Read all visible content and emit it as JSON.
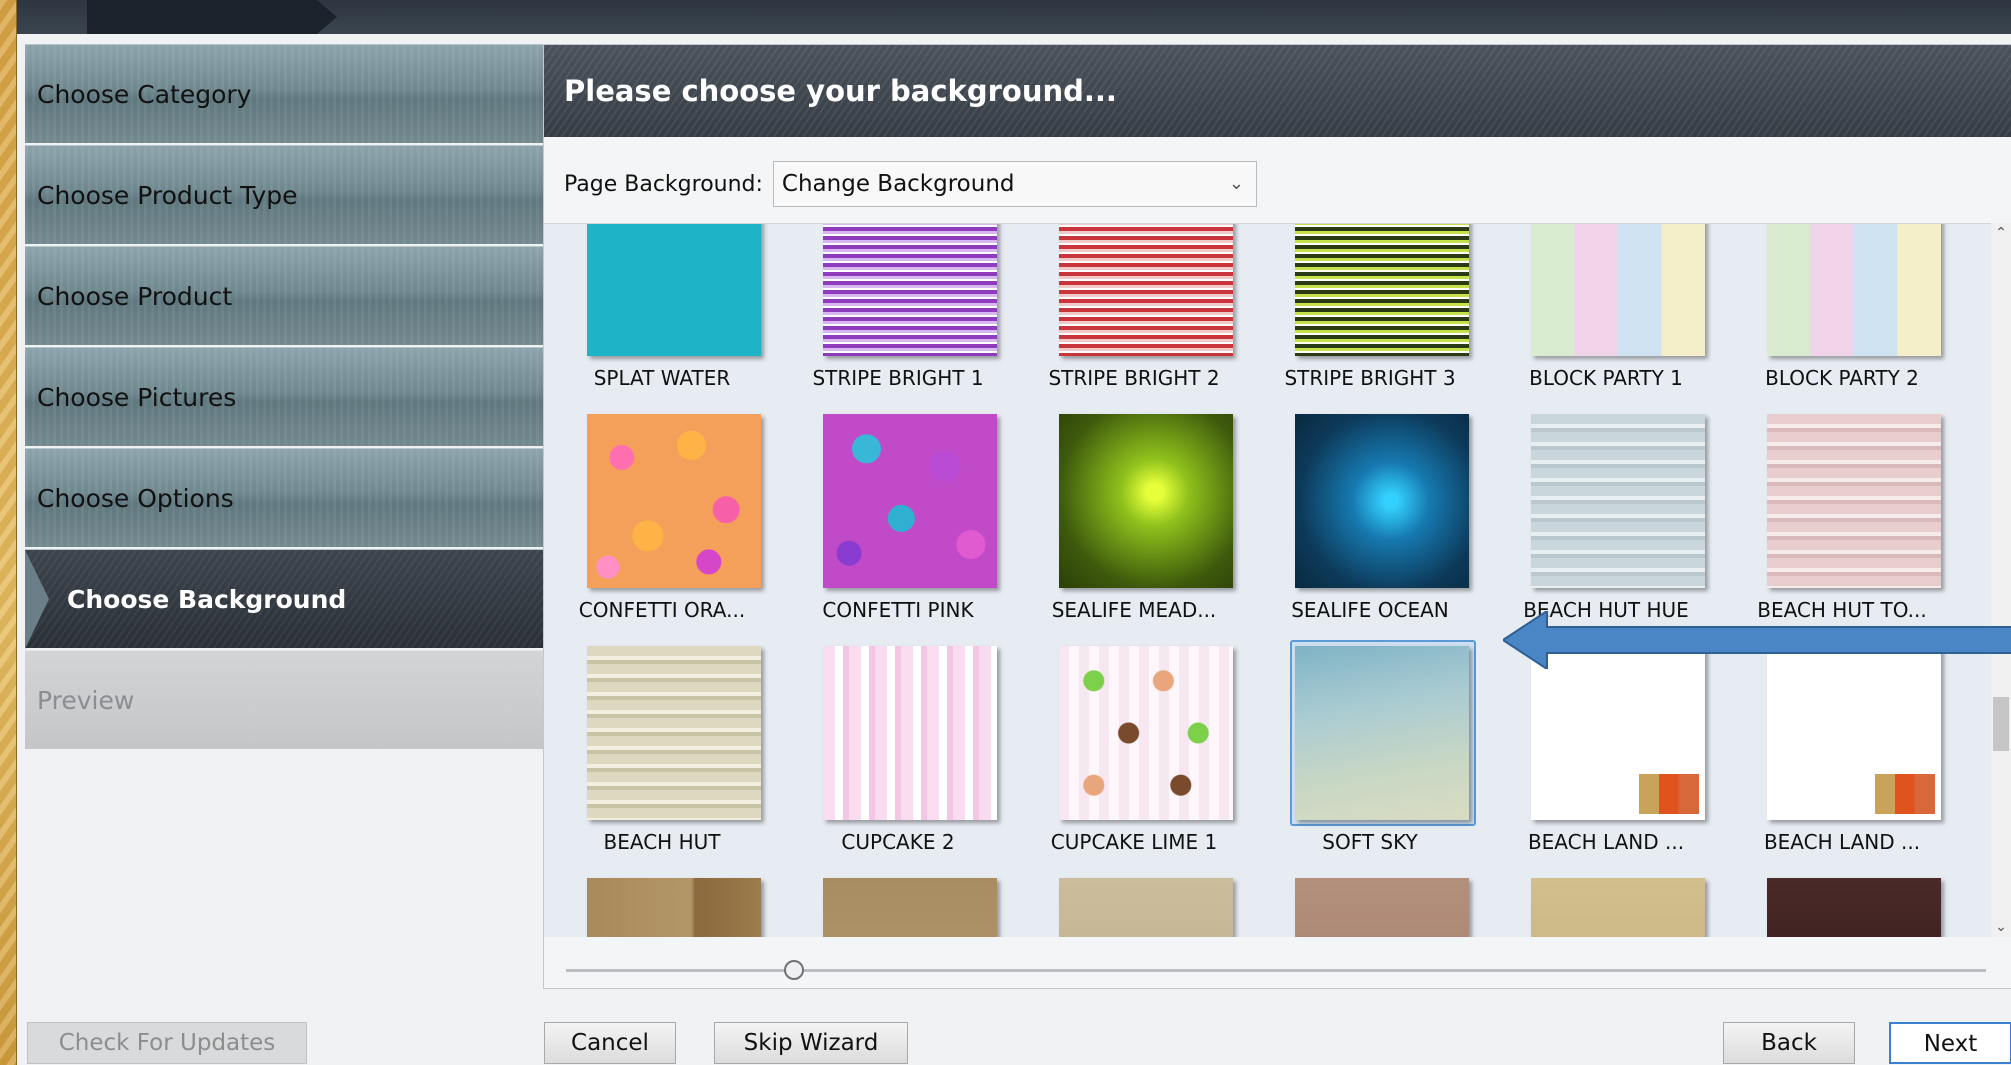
{
  "nav": {
    "items": [
      {
        "label": "Choose Category",
        "state": "normal"
      },
      {
        "label": "Choose Product Type",
        "state": "normal"
      },
      {
        "label": "Choose Product",
        "state": "normal"
      },
      {
        "label": "Choose Pictures",
        "state": "normal"
      },
      {
        "label": "Choose Options",
        "state": "normal"
      },
      {
        "label": "Choose Background",
        "state": "active"
      },
      {
        "label": "Preview",
        "state": "disabled"
      }
    ]
  },
  "header": {
    "title": "Please choose your background..."
  },
  "background_select": {
    "label": "Page Background:",
    "value": "Change Background"
  },
  "thumbnails": [
    {
      "caption": "SPLAT WATER",
      "texture": "t-splat"
    },
    {
      "caption": "STRIPE BRIGHT 1",
      "texture": "t-stripe1"
    },
    {
      "caption": "STRIPE BRIGHT 2",
      "texture": "t-stripe2"
    },
    {
      "caption": "STRIPE BRIGHT 3",
      "texture": "t-stripe3"
    },
    {
      "caption": "BLOCK PARTY 1",
      "texture": "t-block"
    },
    {
      "caption": "BLOCK PARTY 2",
      "texture": "t-block"
    },
    {
      "caption": "CONFETTI ORA...",
      "texture": "t-confetti-ora"
    },
    {
      "caption": "CONFETTI PINK",
      "texture": "t-confetti-pink"
    },
    {
      "caption": "SEALIFE MEAD...",
      "texture": "t-sealife-mead"
    },
    {
      "caption": "SEALIFE OCEAN",
      "texture": "t-sealife-ocean"
    },
    {
      "caption": "BEACH HUT HUE",
      "texture": "t-beach-hut-hue"
    },
    {
      "caption": "BEACH HUT TO...",
      "texture": "t-beach-hut-to"
    },
    {
      "caption": "BEACH HUT",
      "texture": "t-beach-hut"
    },
    {
      "caption": "CUPCAKE 2",
      "texture": "t-cupcake2"
    },
    {
      "caption": "CUPCAKE LIME 1",
      "texture": "t-cupcake-lime"
    },
    {
      "caption": "SOFT SKY",
      "texture": "t-soft-sky",
      "selected": true
    },
    {
      "caption": "BEACH LAND ...",
      "texture": "t-beach-land"
    },
    {
      "caption": "BEACH LAND ...",
      "texture": "t-beach-land"
    },
    {
      "caption": "",
      "texture": "t-brown1"
    },
    {
      "caption": "",
      "texture": "t-brown2"
    },
    {
      "caption": "",
      "texture": "t-beige"
    },
    {
      "caption": "",
      "texture": "t-rose"
    },
    {
      "caption": "",
      "texture": "t-sand"
    },
    {
      "caption": "",
      "texture": "t-dark"
    }
  ],
  "buttons": {
    "check_updates": "Check For Updates",
    "cancel": "Cancel",
    "skip_wizard": "Skip Wizard",
    "back": "Back",
    "next": "Next"
  },
  "colors": {
    "accent": "#3b7fd0",
    "arrow": "#4a86c5",
    "nav_active": "#2a3037"
  }
}
